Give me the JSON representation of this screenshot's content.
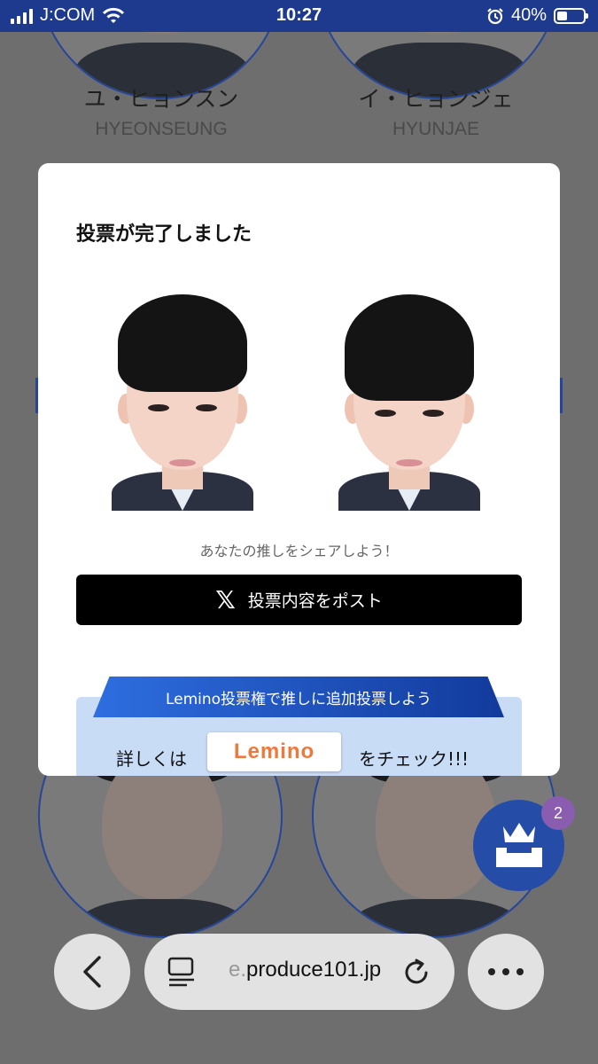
{
  "status_bar": {
    "carrier": "J:COM",
    "time": "10:27",
    "battery": "40%",
    "battery_level": 0.4,
    "icons": [
      "signal-icon",
      "wifi-icon",
      "alarm-icon",
      "battery-icon"
    ]
  },
  "background": {
    "candidates": [
      {
        "name_jp": "ユ・ヒョンスン",
        "name_en": "HYEONSEUNG"
      },
      {
        "name_jp": "イ・ヒョンジェ",
        "name_en": "HYUNJAE"
      }
    ]
  },
  "modal": {
    "title": "投票が完了しました",
    "share_prompt": "あなたの推しをシェアしよう！",
    "post_button_label": "投票内容をポスト",
    "post_button_icon": "x-logo-icon",
    "ribbon_text": "Lemino投票権で推しに追加投票しよう",
    "detail_prefix": "詳しくは",
    "lemino_logo": "Lemino",
    "detail_suffix": "をチェック!!!"
  },
  "vote_fab": {
    "badge_count": "2",
    "icon": "ballot-box-crown-icon"
  },
  "browser": {
    "url": "produce101.jp",
    "url_prefix": "e.",
    "back_icon": "chevron-left-icon",
    "tabs_icon": "tabs-icon",
    "reload_icon": "reload-icon",
    "more_icon": "more-icon"
  },
  "colors": {
    "status_bar": "#1d3a8f",
    "overlay": "#6e6e6e",
    "accent_blue": "#254da8",
    "lemino_orange": "#f0783c",
    "badge_purple": "#8a5db0"
  }
}
